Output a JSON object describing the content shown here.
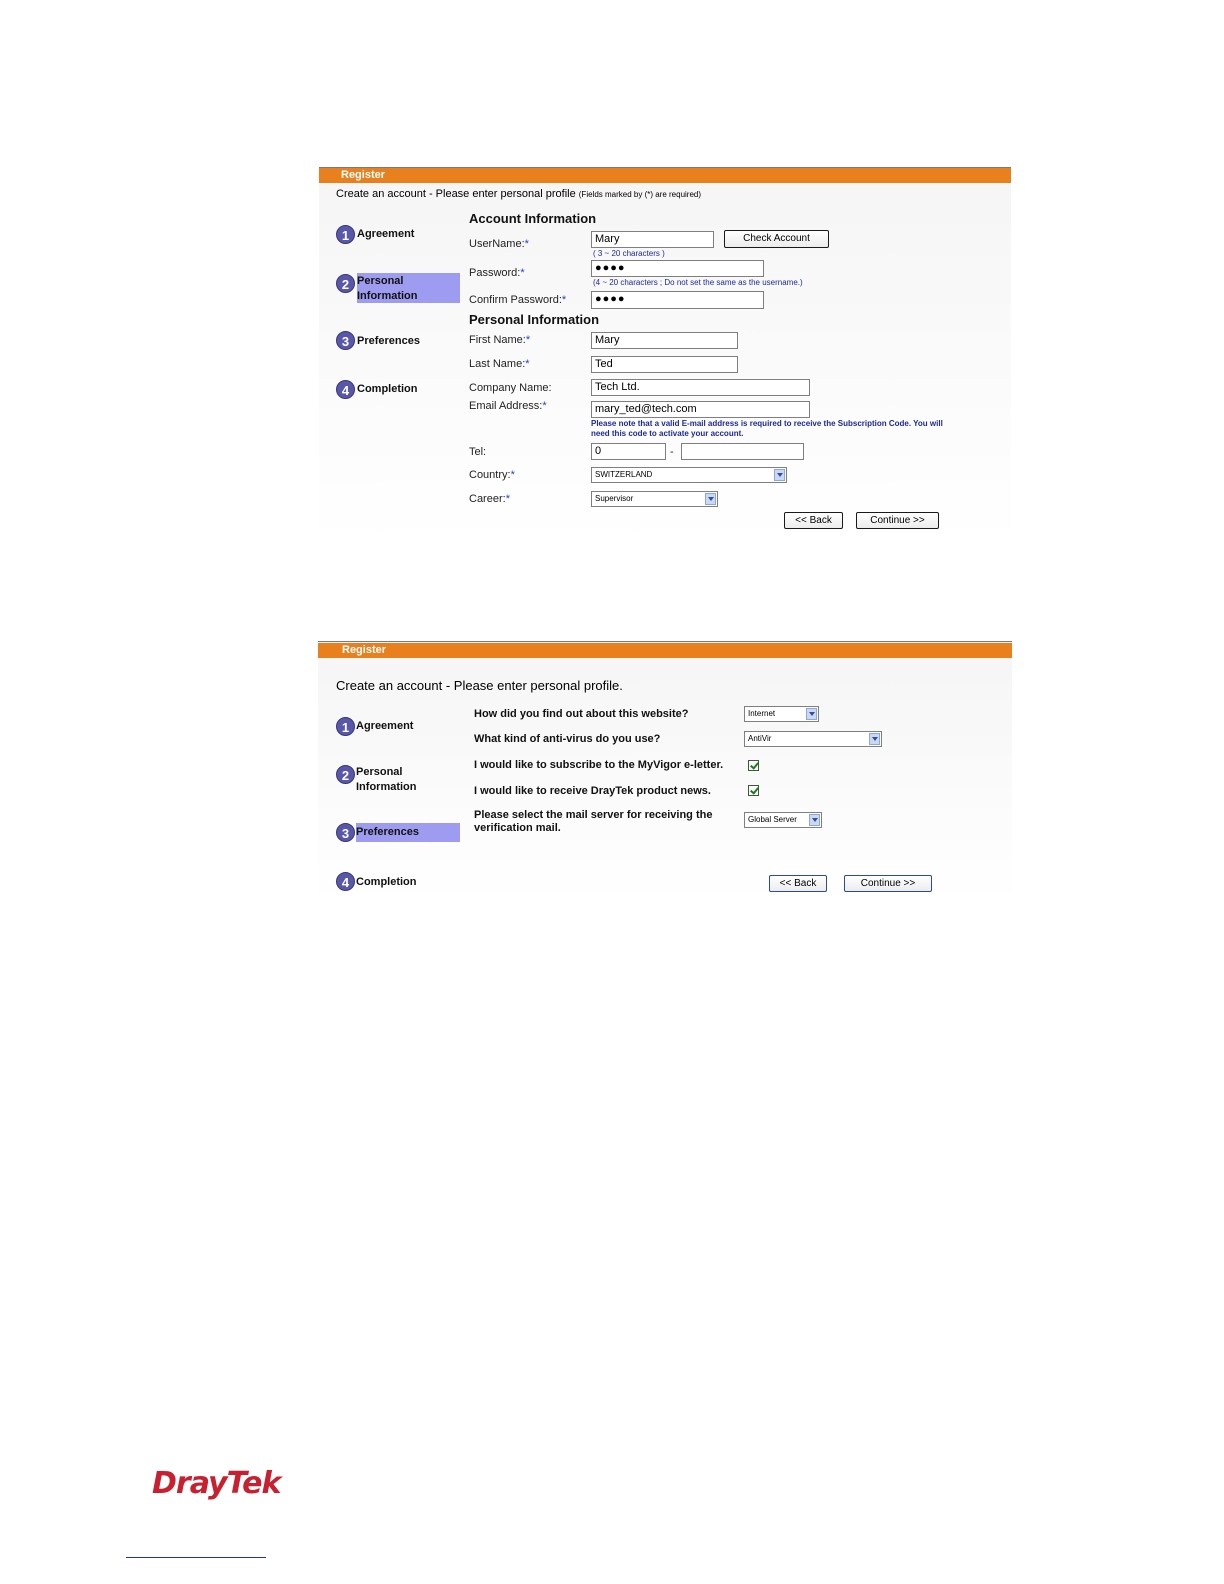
{
  "screen1": {
    "bar_title": "Register",
    "intro": "Create an account - Please enter personal profile",
    "intro_note": "(Fields marked by (*) are required)",
    "steps": [
      {
        "num": "1",
        "line1": "Agreement",
        "line2": ""
      },
      {
        "num": "2",
        "line1": "Personal",
        "line2": "Information"
      },
      {
        "num": "3",
        "line1": "Preferences",
        "line2": ""
      },
      {
        "num": "4",
        "line1": "Completion",
        "line2": ""
      }
    ],
    "account_section": "Account Information",
    "username_label": "UserName:",
    "username_value": "Mary",
    "check_account": "Check Account",
    "username_hint": "( 3 ~ 20 characters )",
    "password_label": "Password:",
    "password_value": "●●●●",
    "password_hint": "(4 ~ 20 characters ; Do not set the same as the username.)",
    "confirm_label": "Confirm Password:",
    "confirm_value": "●●●●",
    "personal_section": "Personal Information",
    "first_name_label": "First Name:",
    "first_name_value": "Mary",
    "last_name_label": "Last Name:",
    "last_name_value": "Ted",
    "company_label": "Company Name:",
    "company_value": "Tech Ltd.",
    "email_label": "Email Address:",
    "email_value": "mary_ted@tech.com",
    "email_note_1": "Please note that a valid E-mail address is required to receive the Subscription Code. You will",
    "email_note_2": "need this code to activate your account.",
    "tel_label": "Tel:",
    "tel_area": "0",
    "tel_sep": "-",
    "tel_number": "",
    "country_label": "Country:",
    "country_value": "SWITZERLAND",
    "career_label": "Career:",
    "career_value": "Supervisor",
    "required_mark": "*",
    "back": "<< Back",
    "continue": "Continue >>"
  },
  "screen2": {
    "bar_title": "Register",
    "intro": "Create an account - Please enter personal profile.",
    "steps": [
      {
        "num": "1",
        "line1": "Agreement",
        "line2": ""
      },
      {
        "num": "2",
        "line1": "Personal",
        "line2": "Information"
      },
      {
        "num": "3",
        "line1": "Preferences",
        "line2": ""
      },
      {
        "num": "4",
        "line1": "Completion",
        "line2": ""
      }
    ],
    "q_find": "How did you find out about this website?",
    "find_value": "Internet",
    "q_antivirus": "What kind of anti-virus do you use?",
    "antivirus_value": "AntiVir",
    "q_subscribe": "I would like to subscribe to the MyVigor e-letter.",
    "q_news": "I would like to receive DrayTek product news.",
    "q_mail_1": "Please select the mail server for receiving the",
    "q_mail_2": "verification mail.",
    "mail_value": "Global Server",
    "back": "<< Back",
    "continue": "Continue >>"
  },
  "footer": {
    "logo": "DrayTek"
  }
}
